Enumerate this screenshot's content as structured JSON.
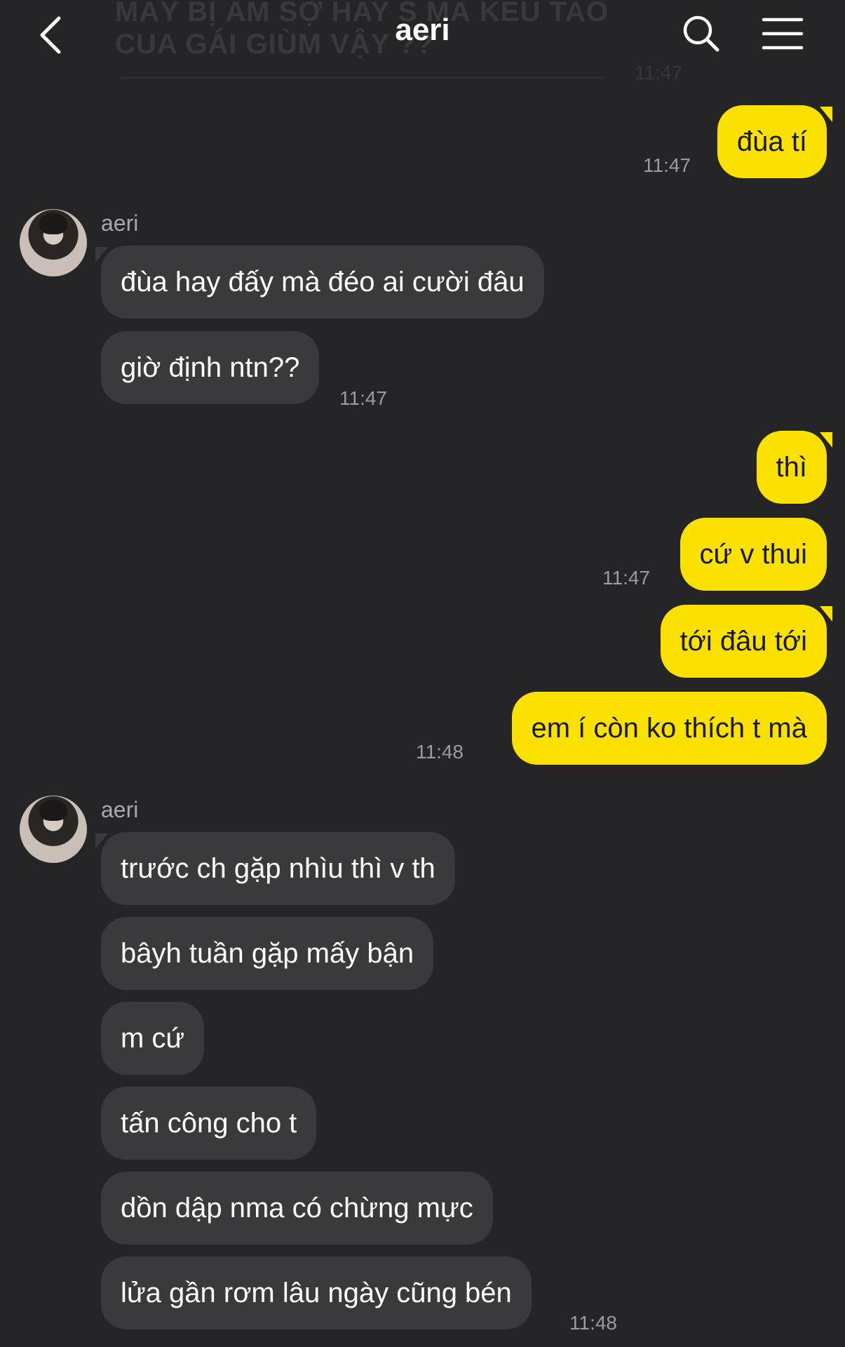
{
  "header": {
    "title": "aeri",
    "ghost_text": "MÀY BỊ ÁM SỢ HAY S MÀ KÊU TAO CUA GÁI GIÙM VẬY ??",
    "ghost_time": "11:47"
  },
  "messages": [
    {
      "sender": "me",
      "text": "đùa tí",
      "time": "11:47"
    },
    {
      "sender": "aeri",
      "name": "aeri",
      "text": "đùa hay đấy mà đéo ai cười đâu"
    },
    {
      "sender": "aeri",
      "text": "giờ định ntn??",
      "time": "11:47"
    },
    {
      "sender": "me",
      "text": "thì"
    },
    {
      "sender": "me",
      "text": "cứ v thui",
      "time": "11:47"
    },
    {
      "sender": "me",
      "text": "tới đâu tới"
    },
    {
      "sender": "me",
      "text": "em í còn ko thích t mà",
      "time": "11:48"
    },
    {
      "sender": "aeri",
      "name": "aeri",
      "text": "trước ch gặp nhìu thì v th"
    },
    {
      "sender": "aeri",
      "text": "bâyh tuần gặp mấy bận"
    },
    {
      "sender": "aeri",
      "text": "m cứ"
    },
    {
      "sender": "aeri",
      "text": "tấn công cho t"
    },
    {
      "sender": "aeri",
      "text": "dồn dập nma có chừng mực"
    },
    {
      "sender": "aeri",
      "text": "lửa gần rơm lâu ngày cũng bén",
      "time": "11:48"
    }
  ],
  "colors": {
    "mine": "#fae100",
    "theirs": "#3a3a3d",
    "background": "#252527"
  }
}
